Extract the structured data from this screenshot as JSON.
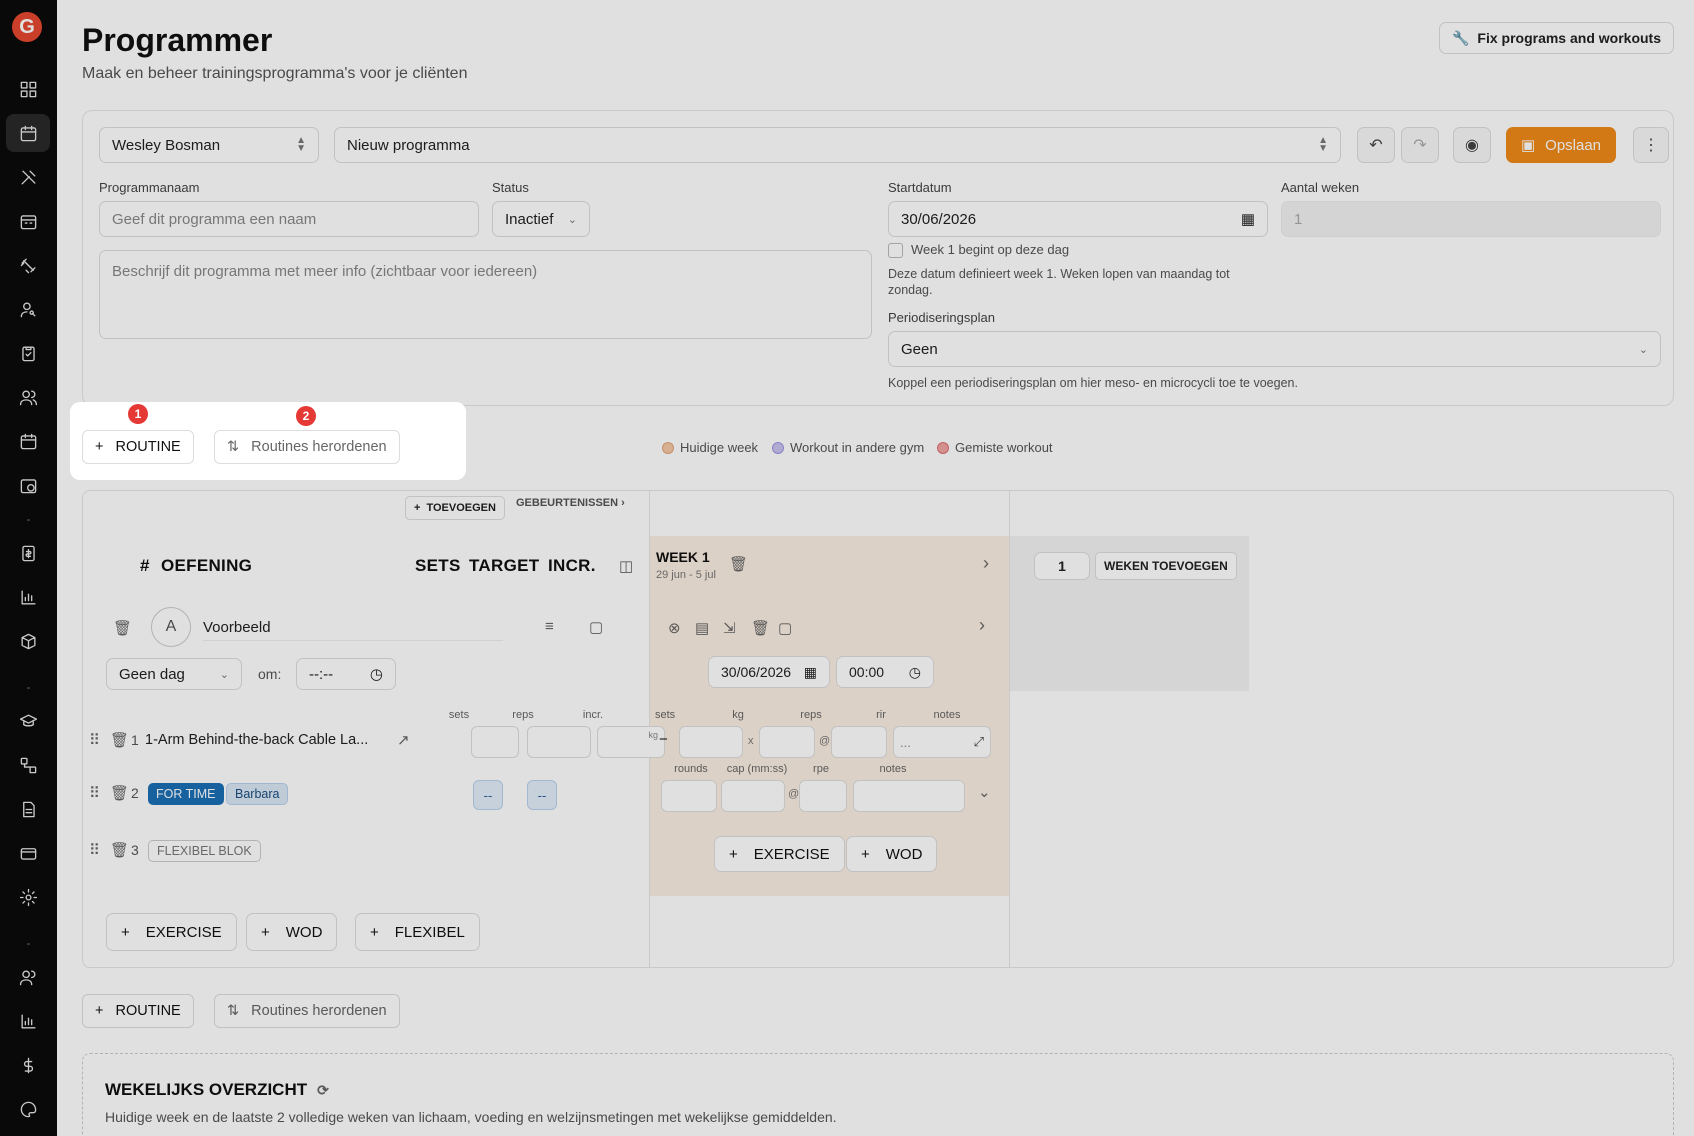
{
  "app": {
    "logo_letter": "G"
  },
  "header": {
    "title": "Programmer",
    "subtitle": "Maak en beheer trainingsprogramma's voor je cliënten",
    "fix_button": "Fix programs and workouts"
  },
  "form": {
    "client": "Wesley Bosman",
    "program_select": "Nieuw programma",
    "save_label": "Opslaan",
    "name_label": "Programmanaam",
    "name_placeholder": "Geef dit programma een naam",
    "status_label": "Status",
    "status_value": "Inactief",
    "description_placeholder": "Beschrijf dit programma met meer info (zichtbaar voor iedereen)",
    "start_label": "Startdatum",
    "start_value": "30/06/2026",
    "weeks_label": "Aantal weken",
    "weeks_value": "1",
    "week1_checkbox": "Week 1 begint op deze dag",
    "date_help": "Deze datum definieert week 1. Weken lopen van maandag tot zondag.",
    "period_label": "Periodiseringsplan",
    "period_value": "Geen",
    "period_help": "Koppel een periodiseringsplan om hier meso- en microcycli toe te voegen."
  },
  "routine_bar": {
    "add_routine": "ROUTINE",
    "reorder": "Routines herordenen",
    "markers": [
      "1",
      "2"
    ],
    "legend": [
      {
        "label": "Huidige week",
        "color": "#f4c9a6"
      },
      {
        "label": "Workout in andere gym",
        "color": "#c9c3f0"
      },
      {
        "label": "Gemiste workout",
        "color": "#f2a3a3"
      }
    ]
  },
  "editor": {
    "add_event": "TOEVOEGEN",
    "events": "GEBEURTENISSEN ›",
    "columns": {
      "num": "#",
      "exercise": "OEFENING",
      "sets": "SETS",
      "target": "TARGET",
      "incr": "INCR."
    },
    "week": {
      "title": "WEEK 1",
      "range": "29 jun - 5 jul"
    },
    "weeks_input": "1",
    "add_weeks": "WEKEN TOEVOEGEN",
    "routine": {
      "letter": "A",
      "name": "Voorbeeld",
      "day": "Geen dag",
      "at_label": "om:",
      "time_placeholder": "--:--",
      "week_date": "30/06/2026",
      "week_time": "00:00"
    },
    "sub_labels": {
      "sets": "sets",
      "reps": "reps",
      "incr": "incr.",
      "kg": "kg",
      "rir": "rir",
      "notes": "notes",
      "rounds": "rounds",
      "cap": "cap (mm:ss)",
      "rpe": "rpe",
      "unit": "kg"
    },
    "rows": [
      {
        "num": "1",
        "name": "1-Arm Behind-the-back Cable La...",
        "notes": "..."
      },
      {
        "num": "2",
        "badge1": "FOR TIME",
        "badge2": "Barbara",
        "dash": "--"
      },
      {
        "num": "3",
        "badge": "FLEXIBEL BLOK"
      }
    ],
    "buttons": {
      "exercise": "EXERCISE",
      "wod": "WOD",
      "flexibel": "FLEXIBEL"
    }
  },
  "bottom_bar": {
    "add_routine": "ROUTINE",
    "reorder": "Routines herordenen"
  },
  "weekly": {
    "title": "WEKELIJKS OVERZICHT",
    "subtitle": "Huidige week en de laatste 2 volledige weken van lichaam, voeding en welzijnsmetingen met wekelijkse gemiddelden."
  }
}
